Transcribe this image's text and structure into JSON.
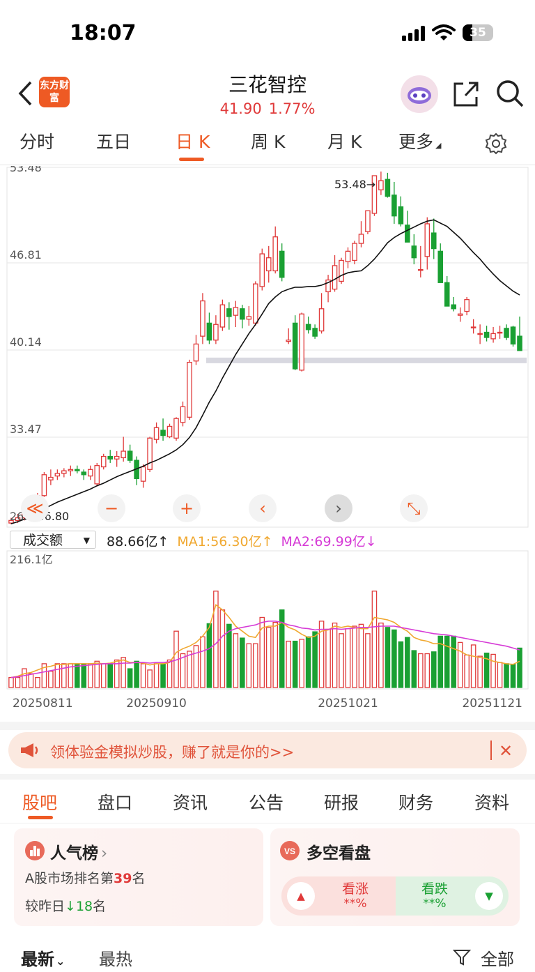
{
  "status_bar": {
    "time": "18:07",
    "battery": "35"
  },
  "header": {
    "logo_text": "东方财富",
    "stock_name": "三花智控",
    "price": "41.90",
    "change_pct": "1.77%"
  },
  "period_tabs": [
    "分时",
    "五日",
    "日 K",
    "周 K",
    "月 K",
    "更多"
  ],
  "active_period_tab": "日 K",
  "chart_data": [
    {
      "type": "candlestick",
      "title": "日K",
      "y_ticks": [
        "53.48",
        "46.81",
        "40.14",
        "33.47",
        "26.80"
      ],
      "ylim": [
        26.8,
        53.48
      ],
      "annotations": {
        "high": "53.48→",
        "low": "←26.80"
      },
      "series": [
        {
          "name": "K",
          "ohlc": [
            [
              26.9,
              27.3,
              26.8,
              27.1
            ],
            [
              27.1,
              27.6,
              26.9,
              27.3
            ],
            [
              27.3,
              27.8,
              27.1,
              27.6
            ],
            [
              27.6,
              28.5,
              27.4,
              28.3
            ],
            [
              28.3,
              29.2,
              28.1,
              29.0
            ],
            [
              29.0,
              30.8,
              28.9,
              30.6
            ],
            [
              30.2,
              31.0,
              29.8,
              30.4
            ],
            [
              30.5,
              31.0,
              30.2,
              30.7
            ],
            [
              30.7,
              31.1,
              30.4,
              30.9
            ],
            [
              30.9,
              31.3,
              30.5,
              31.0
            ],
            [
              31.0,
              31.3,
              30.7,
              30.9
            ],
            [
              30.8,
              31.0,
              30.2,
              30.6
            ],
            [
              30.5,
              31.3,
              30.2,
              31.0
            ],
            [
              29.9,
              31.5,
              29.7,
              31.3
            ],
            [
              31.2,
              32.2,
              31.0,
              32.0
            ],
            [
              32.0,
              32.5,
              31.5,
              31.8
            ],
            [
              31.8,
              32.4,
              31.2,
              32.0
            ],
            [
              31.9,
              33.5,
              31.6,
              32.4
            ],
            [
              32.4,
              32.9,
              31.5,
              31.7
            ],
            [
              31.7,
              32.0,
              29.8,
              30.3
            ],
            [
              30.1,
              31.4,
              29.6,
              31.2
            ],
            [
              31.0,
              33.5,
              30.8,
              33.4
            ],
            [
              33.3,
              34.6,
              33.0,
              34.2
            ],
            [
              34.0,
              34.9,
              33.2,
              33.6
            ],
            [
              33.5,
              34.5,
              33.4,
              34.3
            ],
            [
              33.4,
              35.0,
              33.2,
              34.9
            ],
            [
              34.6,
              36.2,
              34.3,
              35.8
            ],
            [
              35.0,
              39.4,
              34.8,
              39.2
            ],
            [
              39.3,
              41.3,
              39.0,
              40.6
            ],
            [
              41.2,
              44.5,
              40.6,
              43.9
            ],
            [
              42.2,
              43.0,
              40.6,
              40.9
            ],
            [
              40.9,
              42.8,
              40.6,
              42.1
            ],
            [
              41.9,
              44.0,
              41.6,
              43.6
            ],
            [
              43.3,
              43.8,
              41.7,
              42.7
            ],
            [
              42.8,
              43.9,
              41.9,
              43.4
            ],
            [
              43.3,
              43.6,
              41.8,
              42.5
            ],
            [
              42.5,
              43.5,
              42.0,
              42.7
            ],
            [
              42.2,
              45.4,
              42.0,
              45.2
            ],
            [
              45.0,
              47.9,
              44.7,
              47.5
            ],
            [
              46.2,
              48.1,
              45.3,
              47.2
            ],
            [
              46.2,
              49.6,
              46.0,
              48.8
            ],
            [
              47.7,
              48.3,
              45.4,
              45.7
            ],
            [
              40.8,
              41.8,
              40.6,
              40.9
            ],
            [
              42.2,
              42.8,
              38.6,
              38.7
            ],
            [
              38.6,
              43.0,
              38.5,
              42.9
            ],
            [
              42.1,
              42.7,
              41.4,
              41.7
            ],
            [
              41.8,
              42.1,
              41.0,
              41.2
            ],
            [
              41.6,
              44.5,
              41.4,
              43.3
            ],
            [
              44.6,
              45.9,
              43.8,
              45.5
            ],
            [
              44.8,
              47.4,
              44.6,
              46.6
            ],
            [
              45.4,
              47.2,
              45.2,
              47.0
            ],
            [
              46.9,
              48.0,
              46.4,
              47.7
            ],
            [
              47.0,
              48.5,
              46.7,
              48.3
            ],
            [
              48.3,
              50.0,
              48.0,
              49.0
            ],
            [
              49.2,
              50.6,
              49.0,
              50.8
            ],
            [
              50.6,
              53.4,
              50.4,
              53.48
            ],
            [
              52.4,
              53.8,
              52.0,
              53.1
            ],
            [
              53.2,
              53.7,
              51.8,
              51.9
            ],
            [
              52.0,
              53.0,
              49.8,
              50.4
            ],
            [
              51.1,
              51.9,
              49.6,
              49.8
            ],
            [
              49.7,
              50.8,
              48.8,
              48.4
            ],
            [
              48.1,
              49.0,
              46.7,
              47.2
            ],
            [
              46.3,
              48.1,
              45.7,
              46.3
            ],
            [
              47.3,
              50.3,
              46.3,
              49.8
            ],
            [
              49.1,
              50.2,
              47.1,
              47.9
            ],
            [
              47.7,
              48.3,
              45.4,
              45.3
            ],
            [
              45.3,
              45.8,
              43.6,
              43.5
            ],
            [
              43.6,
              44.2,
              43.1,
              43.3
            ],
            [
              42.8,
              43.4,
              42.3,
              42.9
            ],
            [
              43.1,
              44.2,
              42.8,
              44.0
            ],
            [
              41.9,
              42.5,
              41.4,
              41.9
            ],
            [
              41.4,
              42.1,
              40.6,
              41.4
            ],
            [
              41.5,
              42.0,
              40.8,
              41.1
            ],
            [
              41.0,
              41.9,
              40.7,
              41.4
            ],
            [
              41.5,
              42.0,
              41.0,
              41.5
            ],
            [
              41.8,
              42.1,
              40.9,
              41.1
            ],
            [
              41.9,
              42.0,
              40.4,
              40.6
            ],
            [
              41.2,
              42.7,
              40.2,
              40.1
            ]
          ]
        },
        {
          "name": "MA",
          "values": [
            26.85,
            27.0,
            27.2,
            27.45,
            27.7,
            28.0,
            28.25,
            28.5,
            28.7,
            28.9,
            29.1,
            29.3,
            29.5,
            29.75,
            29.95,
            30.2,
            30.45,
            30.65,
            30.85,
            31.05,
            31.25,
            31.5,
            31.7,
            31.95,
            32.2,
            32.5,
            32.9,
            33.45,
            34.2,
            35.15,
            36.15,
            37.0,
            38.0,
            38.9,
            39.8,
            40.6,
            41.4,
            42.1,
            42.9,
            43.7,
            44.2,
            44.6,
            44.8,
            44.95,
            44.95,
            45.0,
            45.0,
            45.1,
            45.3,
            45.55,
            45.85,
            46.05,
            46.15,
            46.2,
            46.6,
            47.1,
            47.7,
            48.35,
            48.75,
            49.05,
            49.3,
            49.55,
            49.8,
            50.0,
            50.1,
            49.85,
            49.6,
            49.15,
            48.7,
            48.15,
            47.6,
            47.1,
            46.5,
            45.95,
            45.45,
            45.05,
            44.65,
            44.35
          ]
        }
      ]
    },
    {
      "type": "bar",
      "title": "成交额",
      "xlabel_ticks": [
        "20250811",
        "20250910",
        "20251021",
        "20251121"
      ],
      "y_top_label": "216.1亿",
      "ylim": [
        0,
        216.1
      ],
      "legend": {
        "selector": "成交额",
        "current": "88.66亿↑",
        "ma1": "MA1:56.30亿↑",
        "ma2": "MA2:69.99亿↓"
      },
      "series": [
        {
          "name": "成交额",
          "values": [
            16,
            16,
            30,
            22,
            16,
            38,
            26,
            38,
            38,
            38,
            38,
            38,
            38,
            42,
            38,
            38,
            44,
            48,
            30,
            42,
            38,
            28,
            38,
            38,
            44,
            90,
            54,
            58,
            67,
            81,
            102,
            154,
            124,
            101,
            86,
            79,
            70,
            70,
            112,
            96,
            104,
            124,
            74,
            74,
            77,
            81,
            89,
            106,
            93,
            103,
            86,
            94,
            98,
            101,
            86,
            154,
            103,
            96,
            92,
            73,
            80,
            59,
            54,
            54,
            57,
            82,
            82,
            82,
            72,
            52,
            68,
            50,
            55,
            53,
            40,
            38,
            37,
            63
          ]
        },
        {
          "name": "MA1",
          "values": [
            16,
            18,
            22,
            24,
            28,
            32,
            34,
            37,
            37,
            38,
            38,
            38,
            38,
            39,
            38,
            39,
            42,
            44,
            40,
            40,
            39,
            36,
            38,
            38,
            40,
            56,
            62,
            66,
            72,
            82,
            96,
            132,
            124,
            112,
            98,
            90,
            82,
            80,
            95,
            98,
            98,
            104,
            96,
            92,
            85,
            80,
            82,
            90,
            92,
            98,
            96,
            98,
            96,
            94,
            94,
            112,
            110,
            108,
            104,
            96,
            90,
            80,
            76,
            74,
            70,
            70,
            66,
            62,
            58,
            52,
            50,
            48,
            46,
            42,
            40,
            38,
            37,
            42
          ]
        },
        {
          "name": "MA2",
          "values": [
            16,
            17,
            19,
            21,
            23,
            25,
            27,
            29,
            31,
            33,
            34,
            35,
            36,
            37,
            38,
            38,
            38,
            39,
            39,
            40,
            40,
            39,
            40,
            40,
            41,
            44,
            48,
            52,
            55,
            58,
            62,
            70,
            82,
            90,
            94,
            96,
            98,
            100,
            104,
            106,
            106,
            104,
            100,
            98,
            95,
            94,
            92,
            93,
            93,
            94,
            93,
            94,
            95,
            96,
            96,
            97,
            98,
            98,
            98,
            96,
            94,
            92,
            90,
            88,
            86,
            85,
            84,
            82,
            80,
            78,
            76,
            74,
            72,
            70,
            68,
            66,
            63,
            60
          ]
        }
      ]
    }
  ],
  "chart_controls": [
    "≪",
    "−",
    "+",
    "‹",
    "›",
    "⤡"
  ],
  "promo": {
    "text": "领体验金模拟炒股，赚了就是你的>>",
    "close": "✕"
  },
  "content_tabs": [
    "股吧",
    "盘口",
    "资讯",
    "公告",
    "研报",
    "财务",
    "资料"
  ],
  "active_content_tab": "股吧",
  "popular": {
    "title": "人气榜",
    "rank_prefix": "A股市场排名第",
    "rank": "39",
    "rank_suffix": "名",
    "change_prefix": "较昨日",
    "change_value": "18",
    "change_suffix": "名"
  },
  "vs_panel": {
    "title": "多空看盘",
    "bull_label": "看涨",
    "bull_pct": "**%",
    "bear_label": "看跌",
    "bear_pct": "**%"
  },
  "feed_filters": {
    "latest": "最新",
    "hot": "最热",
    "all": "全部"
  },
  "colors": {
    "up": "#e03a3a",
    "down": "#1aa033",
    "ma1": "#f0a830",
    "ma2": "#d63bd6",
    "accent": "#ee5a24"
  }
}
